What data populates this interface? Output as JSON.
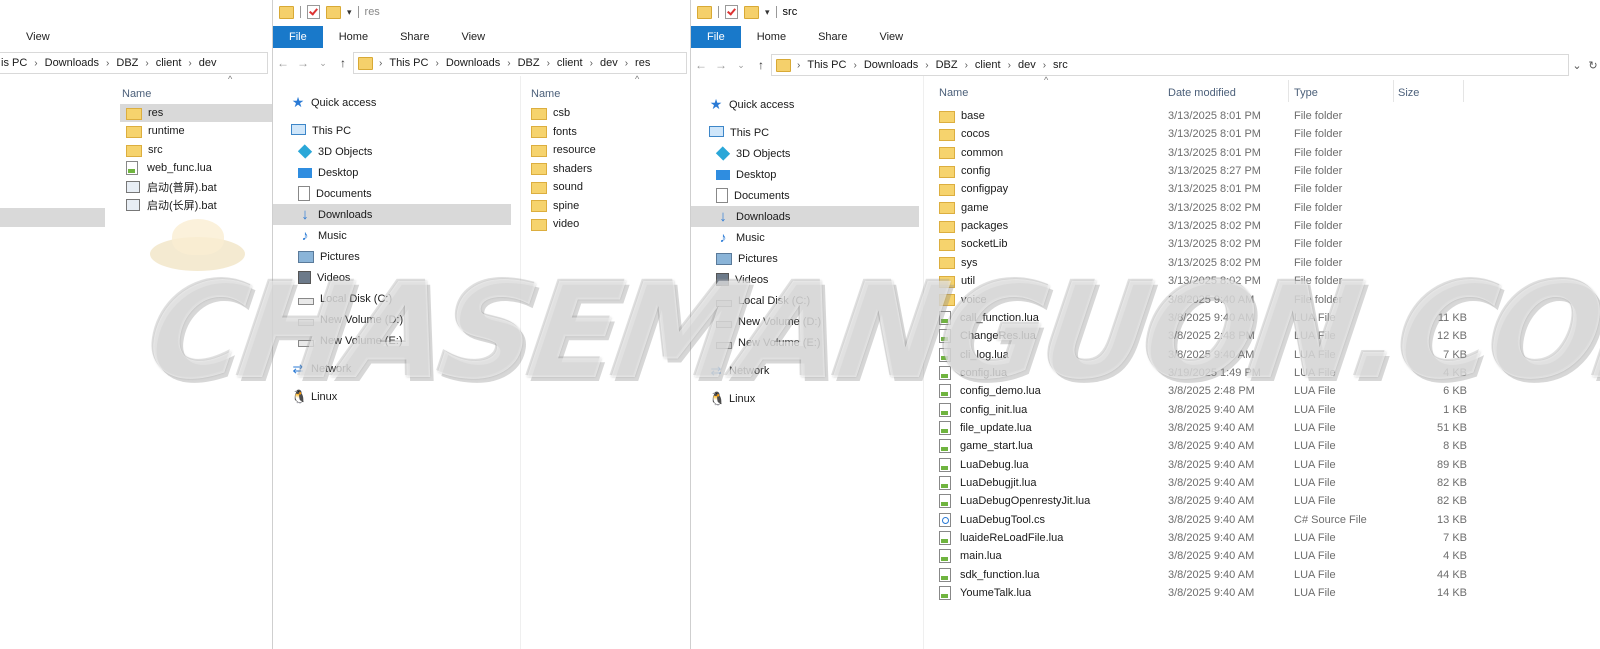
{
  "window1": {
    "ribbon_tab": "View",
    "breadcrumb": [
      "is PC",
      "Downloads",
      "DBZ",
      "client",
      "dev"
    ],
    "name_header": "Name",
    "files": [
      {
        "name": "res",
        "kind": "folder",
        "selected": true
      },
      {
        "name": "runtime",
        "kind": "folder"
      },
      {
        "name": "src",
        "kind": "folder"
      },
      {
        "name": "web_func.lua",
        "kind": "lua"
      },
      {
        "name": "启动(普屏).bat",
        "kind": "bat"
      },
      {
        "name": "启动(长屏).bat",
        "kind": "bat"
      }
    ]
  },
  "window2": {
    "title": "res",
    "ribbon": [
      "File",
      "Home",
      "Share",
      "View"
    ],
    "breadcrumb": [
      "This PC",
      "Downloads",
      "DBZ",
      "client",
      "dev",
      "res"
    ],
    "name_header": "Name",
    "files": [
      "csb",
      "fonts",
      "resource",
      "shaders",
      "sound",
      "spine",
      "video"
    ]
  },
  "window3": {
    "title": "src",
    "ribbon": [
      "File",
      "Home",
      "Share",
      "View"
    ],
    "breadcrumb": [
      "This PC",
      "Downloads",
      "DBZ",
      "client",
      "dev",
      "src"
    ],
    "headers": {
      "name": "Name",
      "date": "Date modified",
      "type": "Type",
      "size": "Size"
    },
    "files": [
      {
        "name": "base",
        "date": "3/13/2025 8:01 PM",
        "type": "File folder",
        "size": "",
        "kind": "folder"
      },
      {
        "name": "cocos",
        "date": "3/13/2025 8:01 PM",
        "type": "File folder",
        "size": "",
        "kind": "folder"
      },
      {
        "name": "common",
        "date": "3/13/2025 8:01 PM",
        "type": "File folder",
        "size": "",
        "kind": "folder"
      },
      {
        "name": "config",
        "date": "3/13/2025 8:27 PM",
        "type": "File folder",
        "size": "",
        "kind": "folder"
      },
      {
        "name": "configpay",
        "date": "3/13/2025 8:01 PM",
        "type": "File folder",
        "size": "",
        "kind": "folder"
      },
      {
        "name": "game",
        "date": "3/13/2025 8:02 PM",
        "type": "File folder",
        "size": "",
        "kind": "folder"
      },
      {
        "name": "packages",
        "date": "3/13/2025 8:02 PM",
        "type": "File folder",
        "size": "",
        "kind": "folder"
      },
      {
        "name": "socketLib",
        "date": "3/13/2025 8:02 PM",
        "type": "File folder",
        "size": "",
        "kind": "folder"
      },
      {
        "name": "sys",
        "date": "3/13/2025 8:02 PM",
        "type": "File folder",
        "size": "",
        "kind": "folder"
      },
      {
        "name": "util",
        "date": "3/13/2025 8:02 PM",
        "type": "File folder",
        "size": "",
        "kind": "folder"
      },
      {
        "name": "voice",
        "date": "3/8/2025 9:40 AM",
        "type": "File folder",
        "size": "",
        "kind": "folder"
      },
      {
        "name": "call_function.lua",
        "date": "3/8/2025 9:40 AM",
        "type": "LUA File",
        "size": "11 KB",
        "kind": "lua"
      },
      {
        "name": "ChangeRes.lua",
        "date": "3/8/2025 2:48 PM",
        "type": "LUA File",
        "size": "12 KB",
        "kind": "lua"
      },
      {
        "name": "cli_log.lua",
        "date": "3/8/2025 9:40 AM",
        "type": "LUA File",
        "size": "7 KB",
        "kind": "lua"
      },
      {
        "name": "config.lua",
        "date": "3/19/2025 1:49 PM",
        "type": "LUA File",
        "size": "4 KB",
        "kind": "lua"
      },
      {
        "name": "config_demo.lua",
        "date": "3/8/2025 2:48 PM",
        "type": "LUA File",
        "size": "6 KB",
        "kind": "lua"
      },
      {
        "name": "config_init.lua",
        "date": "3/8/2025 9:40 AM",
        "type": "LUA File",
        "size": "1 KB",
        "kind": "lua"
      },
      {
        "name": "file_update.lua",
        "date": "3/8/2025 9:40 AM",
        "type": "LUA File",
        "size": "51 KB",
        "kind": "lua"
      },
      {
        "name": "game_start.lua",
        "date": "3/8/2025 9:40 AM",
        "type": "LUA File",
        "size": "8 KB",
        "kind": "lua"
      },
      {
        "name": "LuaDebug.lua",
        "date": "3/8/2025 9:40 AM",
        "type": "LUA File",
        "size": "89 KB",
        "kind": "lua"
      },
      {
        "name": "LuaDebugjit.lua",
        "date": "3/8/2025 9:40 AM",
        "type": "LUA File",
        "size": "82 KB",
        "kind": "lua"
      },
      {
        "name": "LuaDebugOpenrestyJit.lua",
        "date": "3/8/2025 9:40 AM",
        "type": "LUA File",
        "size": "82 KB",
        "kind": "lua"
      },
      {
        "name": "LuaDebugTool.cs",
        "date": "3/8/2025 9:40 AM",
        "type": "C# Source File",
        "size": "13 KB",
        "kind": "cs"
      },
      {
        "name": "luaideReLoadFile.lua",
        "date": "3/8/2025 9:40 AM",
        "type": "LUA File",
        "size": "7 KB",
        "kind": "lua"
      },
      {
        "name": "main.lua",
        "date": "3/8/2025 9:40 AM",
        "type": "LUA File",
        "size": "4 KB",
        "kind": "lua"
      },
      {
        "name": "sdk_function.lua",
        "date": "3/8/2025 9:40 AM",
        "type": "LUA File",
        "size": "44 KB",
        "kind": "lua"
      },
      {
        "name": "YoumeTalk.lua",
        "date": "3/8/2025 9:40 AM",
        "type": "LUA File",
        "size": "14 KB",
        "kind": "lua"
      }
    ]
  },
  "nav": {
    "items": [
      {
        "label": "Quick access",
        "icon": "star-icon",
        "indent": 0
      },
      {
        "label": "This PC",
        "icon": "computer-icon",
        "indent": 0
      },
      {
        "label": "3D Objects",
        "icon": "cube-icon",
        "indent": 1
      },
      {
        "label": "Desktop",
        "icon": "desktop-icon",
        "indent": 1
      },
      {
        "label": "Documents",
        "icon": "document-icon",
        "indent": 1
      },
      {
        "label": "Downloads",
        "icon": "download-icon",
        "indent": 1,
        "selected": true
      },
      {
        "label": "Music",
        "icon": "music-icon",
        "indent": 1
      },
      {
        "label": "Pictures",
        "icon": "picture-icon",
        "indent": 1
      },
      {
        "label": "Videos",
        "icon": "video-icon",
        "indent": 1
      },
      {
        "label": "Local Disk (C:)",
        "icon": "drive-icon",
        "indent": 1
      },
      {
        "label": "New Volume (D:)",
        "icon": "drive-icon",
        "indent": 1
      },
      {
        "label": "New Volume (E:)",
        "icon": "drive-icon",
        "indent": 1
      },
      {
        "label": "Network",
        "icon": "network-icon",
        "indent": 0
      },
      {
        "label": "Linux",
        "icon": "linux-icon",
        "indent": 0
      }
    ]
  },
  "watermark": {
    "text": "CHASEMANGUON.COM"
  },
  "colors": {
    "file_tab": "#1979ca",
    "selection": "#d9d9d9",
    "folder": "#f6d36d",
    "header_text": "#4c607a"
  }
}
